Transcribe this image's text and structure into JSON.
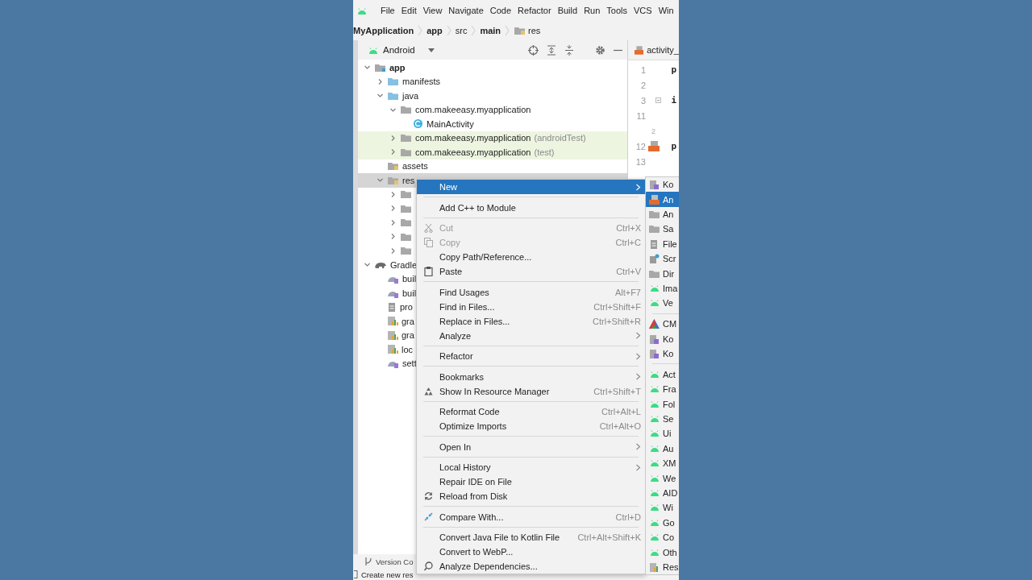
{
  "menu_bar": {
    "items": [
      "File",
      "Edit",
      "View",
      "Navigate",
      "Code",
      "Refactor",
      "Build",
      "Run",
      "Tools",
      "VCS",
      "Win"
    ]
  },
  "breadcrumb": [
    {
      "label": "MyApplication",
      "bold": true,
      "kind": "text"
    },
    {
      "label": "app",
      "bold": true,
      "kind": "text"
    },
    {
      "label": "src",
      "bold": false,
      "kind": "text"
    },
    {
      "label": "main",
      "bold": true,
      "kind": "text"
    },
    {
      "label": "res",
      "bold": false,
      "kind": "folder"
    }
  ],
  "project_panel": {
    "view": "Android",
    "tree": [
      {
        "label": "app",
        "kind": "module",
        "expanded": true,
        "selected": false,
        "highlighted": false,
        "children": [
          {
            "label": "manifests",
            "kind": "folder",
            "expanded": false,
            "selected": false,
            "highlighted": false
          },
          {
            "label": "java",
            "kind": "folder",
            "expanded": true,
            "selected": false,
            "highlighted": false,
            "children": [
              {
                "label": "com.makeeasy.myapplication",
                "kind": "package",
                "expanded": true,
                "selected": false,
                "highlighted": false,
                "children": [
                  {
                    "label": "MainActivity",
                    "kind": "class",
                    "selected": false,
                    "highlighted": false
                  }
                ]
              },
              {
                "label": "com.makeeasy.myapplication",
                "suffix": "(androidTest)",
                "kind": "package",
                "expanded": false,
                "selected": false,
                "highlighted": true
              },
              {
                "label": "com.makeeasy.myapplication",
                "suffix": "(test)",
                "kind": "package",
                "expanded": false,
                "selected": false,
                "highlighted": true
              }
            ]
          },
          {
            "label": "assets",
            "kind": "resfolder",
            "selected": false,
            "highlighted": false
          },
          {
            "label": "res",
            "kind": "resfolder",
            "expanded": true,
            "selected": true,
            "highlighted": false,
            "children": [
              {
                "kind": "package",
                "expanded": false,
                "selected": false,
                "highlighted": false
              },
              {
                "kind": "package",
                "expanded": false,
                "selected": false,
                "highlighted": false
              },
              {
                "kind": "package",
                "expanded": false,
                "selected": false,
                "highlighted": false
              },
              {
                "kind": "package",
                "expanded": false,
                "selected": false,
                "highlighted": false
              },
              {
                "kind": "package",
                "expanded": false,
                "selected": false,
                "highlighted": false
              }
            ]
          }
        ]
      },
      {
        "label": "Gradle",
        "kind": "gradle",
        "expanded": true,
        "selected": false,
        "highlighted": false,
        "children": [
          {
            "label": "buil",
            "kind": "gradle-file",
            "selected": false,
            "highlighted": false
          },
          {
            "label": "buil",
            "kind": "gradle-file",
            "selected": false,
            "highlighted": false
          },
          {
            "label": "pro",
            "kind": "text-file",
            "selected": false,
            "highlighted": false
          },
          {
            "label": "gra",
            "kind": "properties-file",
            "selected": false,
            "highlighted": false
          },
          {
            "label": "gra",
            "kind": "properties-file",
            "selected": false,
            "highlighted": false
          },
          {
            "label": "loc",
            "kind": "properties-file",
            "selected": false,
            "highlighted": false
          },
          {
            "label": "sett",
            "kind": "gradle-file",
            "selected": false,
            "highlighted": false
          }
        ]
      }
    ]
  },
  "editor": {
    "tab": "activity_",
    "lines": [
      {
        "number": "1",
        "code": "p",
        "kind": "line"
      },
      {
        "number": "2",
        "kind": "line"
      },
      {
        "number": "3",
        "code": "i",
        "kind": "fold"
      },
      {
        "number": "11",
        "kind": "line"
      },
      {
        "number": "2",
        "kind": "hint"
      },
      {
        "number": "12",
        "code": "p",
        "kind": "marker"
      },
      {
        "number": "13",
        "kind": "line"
      }
    ]
  },
  "tool_window_bar": {
    "label": "Version Co"
  },
  "status_bar": {
    "text": "Create new res"
  },
  "context_menu": {
    "items": [
      {
        "kind": "plain",
        "label": "New",
        "submenu": true,
        "selected": true,
        "disabled": false
      },
      {
        "kind": "separator"
      },
      {
        "kind": "plain",
        "label": "Add C++ to Module",
        "selected": false,
        "disabled": false
      },
      {
        "kind": "separator"
      },
      {
        "kind": "cut",
        "label": "Cut",
        "shortcut": "Ctrl+X",
        "selected": false,
        "disabled": true
      },
      {
        "kind": "copy",
        "label": "Copy",
        "shortcut": "Ctrl+C",
        "selected": false,
        "disabled": true
      },
      {
        "kind": "plain",
        "label": "Copy Path/Reference...",
        "selected": false,
        "disabled": false
      },
      {
        "kind": "paste",
        "label": "Paste",
        "shortcut": "Ctrl+V",
        "selected": false,
        "disabled": false
      },
      {
        "kind": "separator"
      },
      {
        "kind": "plain",
        "label": "Find Usages",
        "shortcut": "Alt+F7",
        "selected": false,
        "disabled": false
      },
      {
        "kind": "plain",
        "label": "Find in Files...",
        "shortcut": "Ctrl+Shift+F",
        "selected": false,
        "disabled": false
      },
      {
        "kind": "plain",
        "label": "Replace in Files...",
        "shortcut": "Ctrl+Shift+R",
        "selected": false,
        "disabled": false
      },
      {
        "kind": "plain",
        "label": "Analyze",
        "submenu": true,
        "selected": false,
        "disabled": false
      },
      {
        "kind": "separator"
      },
      {
        "kind": "plain",
        "label": "Refactor",
        "submenu": true,
        "selected": false,
        "disabled": false
      },
      {
        "kind": "separator"
      },
      {
        "kind": "plain",
        "label": "Bookmarks",
        "submenu": true,
        "selected": false,
        "disabled": false
      },
      {
        "kind": "resource",
        "label": "Show In Resource Manager",
        "shortcut": "Ctrl+Shift+T",
        "selected": false,
        "disabled": false
      },
      {
        "kind": "separator"
      },
      {
        "kind": "plain",
        "label": "Reformat Code",
        "shortcut": "Ctrl+Alt+L",
        "selected": false,
        "disabled": false
      },
      {
        "kind": "plain",
        "label": "Optimize Imports",
        "shortcut": "Ctrl+Alt+O",
        "selected": false,
        "disabled": false
      },
      {
        "kind": "separator"
      },
      {
        "kind": "plain",
        "label": "Open In",
        "submenu": true,
        "selected": false,
        "disabled": false
      },
      {
        "kind": "separator"
      },
      {
        "kind": "plain",
        "label": "Local History",
        "submenu": true,
        "selected": false,
        "disabled": false
      },
      {
        "kind": "plain",
        "label": "Repair IDE on File",
        "selected": false,
        "disabled": false
      },
      {
        "kind": "reload",
        "label": "Reload from Disk",
        "selected": false,
        "disabled": false
      },
      {
        "kind": "separator"
      },
      {
        "kind": "compare",
        "label": "Compare With...",
        "shortcut": "Ctrl+D",
        "selected": false,
        "disabled": false
      },
      {
        "kind": "separator"
      },
      {
        "kind": "plain",
        "label": "Convert Java File to Kotlin File",
        "shortcut": "Ctrl+Alt+Shift+K",
        "selected": false,
        "disabled": false
      },
      {
        "kind": "plain",
        "label": "Convert to WebP...",
        "selected": false,
        "disabled": false
      },
      {
        "kind": "analyze",
        "label": "Analyze Dependencies...",
        "selected": false,
        "disabled": false
      }
    ]
  },
  "submenu": {
    "items": [
      {
        "kind": "kotlin",
        "label": "Ko",
        "selected": false
      },
      {
        "kind": "layout",
        "label": "An",
        "selected": true
      },
      {
        "kind": "folder",
        "label": "An",
        "selected": false
      },
      {
        "kind": "folder",
        "label": "Sa",
        "selected": false
      },
      {
        "kind": "file",
        "label": "File",
        "selected": false
      },
      {
        "kind": "scratch",
        "label": "Scr",
        "selected": false
      },
      {
        "kind": "folder",
        "label": "Dir",
        "selected": false
      },
      {
        "kind": "android",
        "label": "Ima",
        "selected": false
      },
      {
        "kind": "android",
        "label": "Ve",
        "selected": false
      },
      {
        "kind": "separator"
      },
      {
        "kind": "cmake",
        "label": "CM",
        "selected": false
      },
      {
        "kind": "kotlin",
        "label": "Ko",
        "selected": false
      },
      {
        "kind": "kotlin",
        "label": "Ko",
        "selected": false
      },
      {
        "kind": "separator"
      },
      {
        "kind": "android",
        "label": "Act",
        "selected": false
      },
      {
        "kind": "android",
        "label": "Fra",
        "selected": false
      },
      {
        "kind": "android",
        "label": "Fol",
        "selected": false
      },
      {
        "kind": "android",
        "label": "Se",
        "selected": false
      },
      {
        "kind": "android",
        "label": "Ui",
        "selected": false
      },
      {
        "kind": "android",
        "label": "Au",
        "selected": false
      },
      {
        "kind": "android",
        "label": "XM",
        "selected": false
      },
      {
        "kind": "android",
        "label": "We",
        "selected": false
      },
      {
        "kind": "android",
        "label": "AID",
        "selected": false
      },
      {
        "kind": "android",
        "label": "Wi",
        "selected": false
      },
      {
        "kind": "android",
        "label": "Go",
        "selected": false
      },
      {
        "kind": "android",
        "label": "Co",
        "selected": false
      },
      {
        "kind": "android",
        "label": "Oth",
        "selected": false
      },
      {
        "kind": "resbundle",
        "label": "Res",
        "selected": false
      }
    ]
  }
}
